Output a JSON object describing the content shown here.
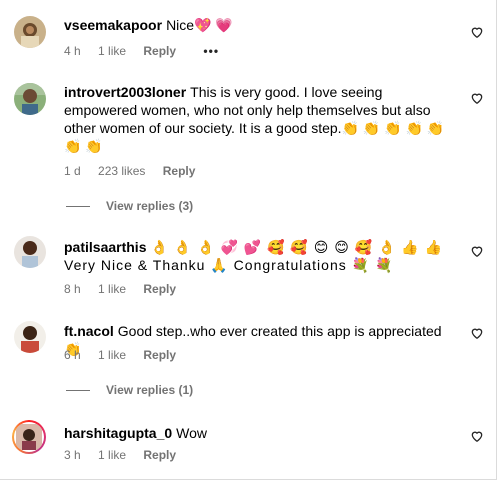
{
  "comments": [
    {
      "username": "vseemakapoor",
      "text": "Nice💖 💗",
      "time": "4 h",
      "likes": "1 like",
      "reply": "Reply",
      "more": "•••"
    },
    {
      "username": "introvert2003loner",
      "text": "This is very good. I love seeing empowered women, who not only help themselves but also other women of our society. It is a good step.👏 👏 👏 👏 👏 👏 👏",
      "time": "1 d",
      "likes": "223 likes",
      "reply": "Reply",
      "view_replies": "View replies (3)"
    },
    {
      "username": "patilsaarthis",
      "text": "👌 👌 👌 💞 💕 🥰 🥰 😊 😊 🥰 👌 👍 👍 Very Nice & Thanku 🙏 Congratulations 💐 💐",
      "time": "8 h",
      "likes": "1 like",
      "reply": "Reply"
    },
    {
      "username": "ft.nacol",
      "text": "Good step..who ever created this app is appreciated👏",
      "time": "6 h",
      "likes": "1 like",
      "reply": "Reply",
      "view_replies": "View replies (1)"
    },
    {
      "username": "harshitagupta_0",
      "text": "Wow",
      "time": "3 h",
      "likes": "1 like",
      "reply": "Reply"
    }
  ],
  "icons": {
    "like": "heart-outline-icon",
    "more": "more-options-icon"
  },
  "colors": {
    "meta": "#737373",
    "text": "#000000",
    "ring": "#e1306c"
  }
}
